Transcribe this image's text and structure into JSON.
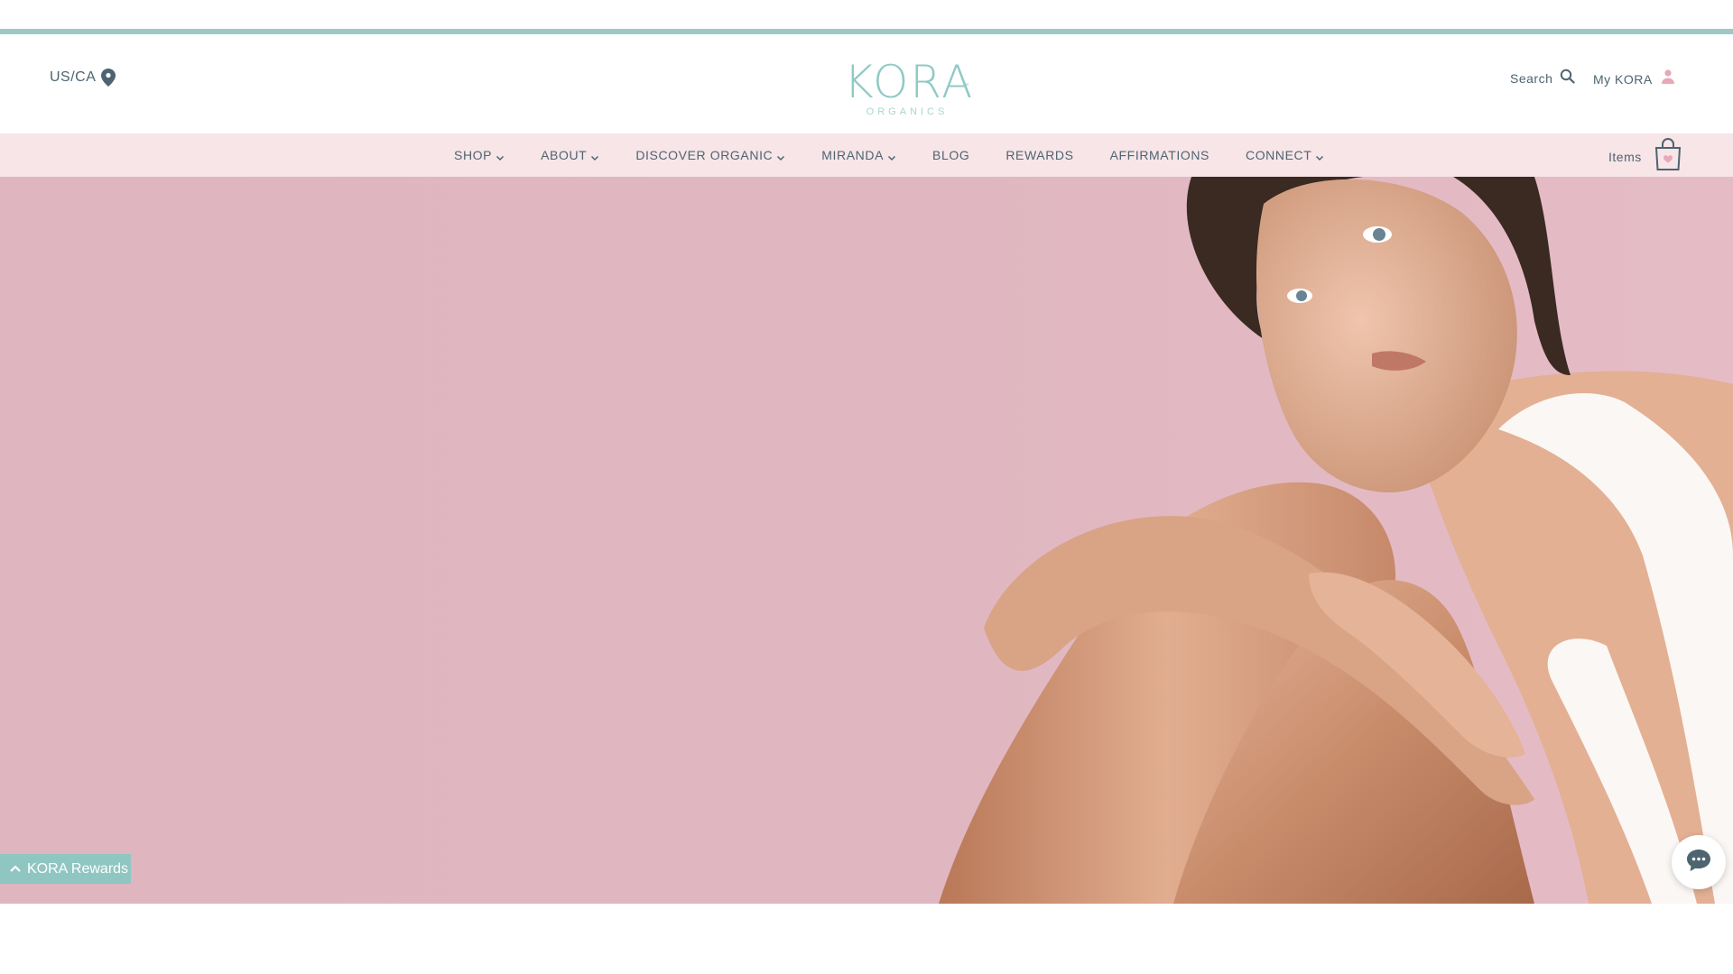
{
  "header": {
    "locale": "US/CA",
    "logo": {
      "name": "KORA",
      "tm": "™",
      "sub": "ORGANICS"
    },
    "search_label": "Search",
    "account_label": "My KORA"
  },
  "nav": {
    "items": [
      {
        "label": "SHOP",
        "dropdown": true
      },
      {
        "label": "ABOUT",
        "dropdown": true
      },
      {
        "label": "DISCOVER ORGANIC",
        "dropdown": true
      },
      {
        "label": "MIRANDA",
        "dropdown": true
      },
      {
        "label": "BLOG",
        "dropdown": false
      },
      {
        "label": "REWARDS",
        "dropdown": false
      },
      {
        "label": "AFFIRMATIONS",
        "dropdown": false
      },
      {
        "label": "CONNECT",
        "dropdown": true
      }
    ],
    "cart_label": "Items"
  },
  "rewards": {
    "label": "KORA Rewards"
  },
  "colors": {
    "accent": "#8fcac4",
    "nav_bg": "#f7e5e8",
    "hero_bg": "#dfb6bf",
    "text": "#4e6470",
    "pink_icon": "#e8a8b8"
  },
  "icons": {
    "locale": "map-pin-icon",
    "search": "search-icon",
    "account": "user-icon",
    "cart": "shopping-bag-icon",
    "chevron": "chevron-down-icon",
    "rewards": "chevron-up-icon",
    "chat": "chat-bubble-icon"
  }
}
